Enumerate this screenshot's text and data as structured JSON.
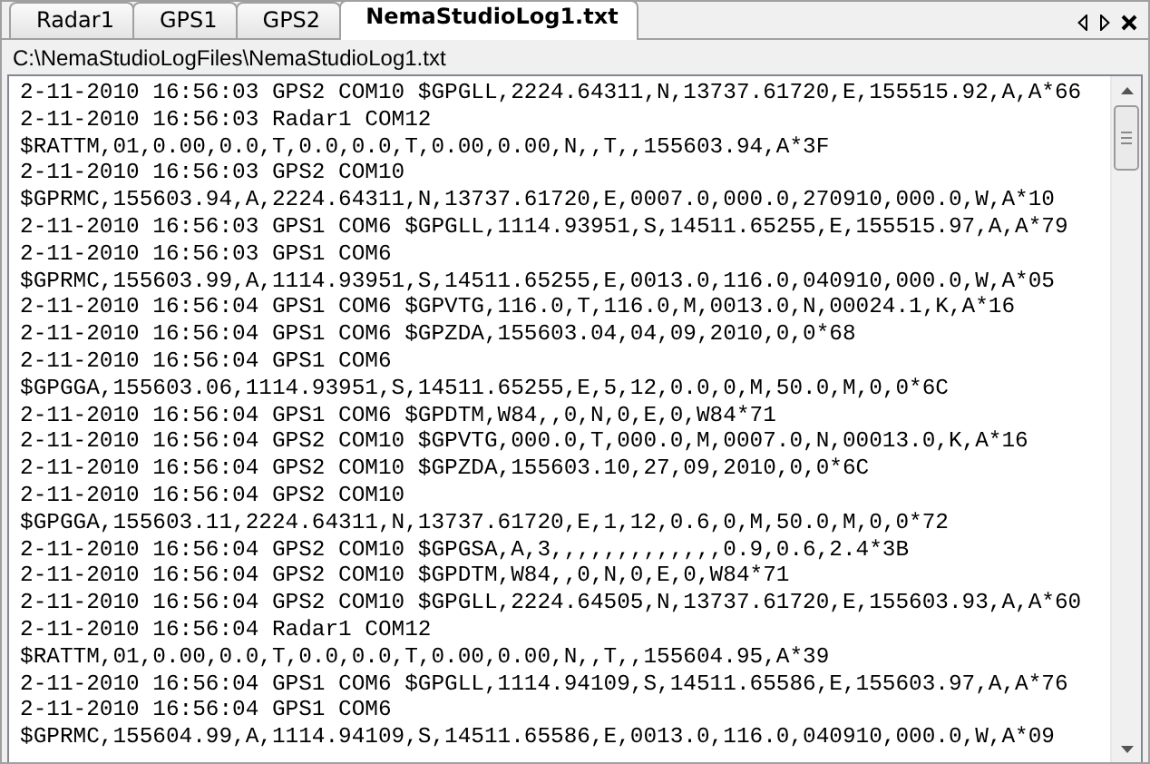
{
  "tabs": [
    {
      "label": "Radar1",
      "selected": false
    },
    {
      "label": "GPS1",
      "selected": false
    },
    {
      "label": "GPS2",
      "selected": false
    },
    {
      "label": "NemaStudioLog1.txt",
      "selected": true
    }
  ],
  "file_path": "C:\\NemaStudioLogFiles\\NemaStudioLog1.txt",
  "log_lines": [
    "2-11-2010 16:56:03 GPS2 COM10 $GPGLL,2224.64311,N,13737.61720,E,155515.92,A,A*66",
    "2-11-2010 16:56:03 Radar1 COM12",
    "$RATTM,01,0.00,0.0,T,0.0,0.0,T,0.00,0.00,N,,T,,155603.94,A*3F",
    "2-11-2010 16:56:03 GPS2 COM10",
    "$GPRMC,155603.94,A,2224.64311,N,13737.61720,E,0007.0,000.0,270910,000.0,W,A*10",
    "2-11-2010 16:56:03 GPS1 COM6 $GPGLL,1114.93951,S,14511.65255,E,155515.97,A,A*79",
    "2-11-2010 16:56:03 GPS1 COM6",
    "$GPRMC,155603.99,A,1114.93951,S,14511.65255,E,0013.0,116.0,040910,000.0,W,A*05",
    "2-11-2010 16:56:04 GPS1 COM6 $GPVTG,116.0,T,116.0,M,0013.0,N,00024.1,K,A*16",
    "2-11-2010 16:56:04 GPS1 COM6 $GPZDA,155603.04,04,09,2010,0,0*68",
    "2-11-2010 16:56:04 GPS1 COM6",
    "$GPGGA,155603.06,1114.93951,S,14511.65255,E,5,12,0.0,0,M,50.0,M,0,0*6C",
    "2-11-2010 16:56:04 GPS1 COM6 $GPDTM,W84,,0,N,0,E,0,W84*71",
    "2-11-2010 16:56:04 GPS2 COM10 $GPVTG,000.0,T,000.0,M,0007.0,N,00013.0,K,A*16",
    "2-11-2010 16:56:04 GPS2 COM10 $GPZDA,155603.10,27,09,2010,0,0*6C",
    "2-11-2010 16:56:04 GPS2 COM10",
    "$GPGGA,155603.11,2224.64311,N,13737.61720,E,1,12,0.6,0,M,50.0,M,0,0*72",
    "2-11-2010 16:56:04 GPS2 COM10 $GPGSA,A,3,,,,,,,,,,,,,0.9,0.6,2.4*3B",
    "2-11-2010 16:56:04 GPS2 COM10 $GPDTM,W84,,0,N,0,E,0,W84*71",
    "2-11-2010 16:56:04 GPS2 COM10 $GPGLL,2224.64505,N,13737.61720,E,155603.93,A,A*60",
    "2-11-2010 16:56:04 Radar1 COM12",
    "$RATTM,01,0.00,0.0,T,0.0,0.0,T,0.00,0.00,N,,T,,155604.95,A*39",
    "2-11-2010 16:56:04 GPS1 COM6 $GPGLL,1114.94109,S,14511.65586,E,155603.97,A,A*76",
    "2-11-2010 16:56:04 GPS1 COM6",
    "$GPRMC,155604.99,A,1114.94109,S,14511.65586,E,0013.0,116.0,040910,000.0,W,A*09"
  ]
}
